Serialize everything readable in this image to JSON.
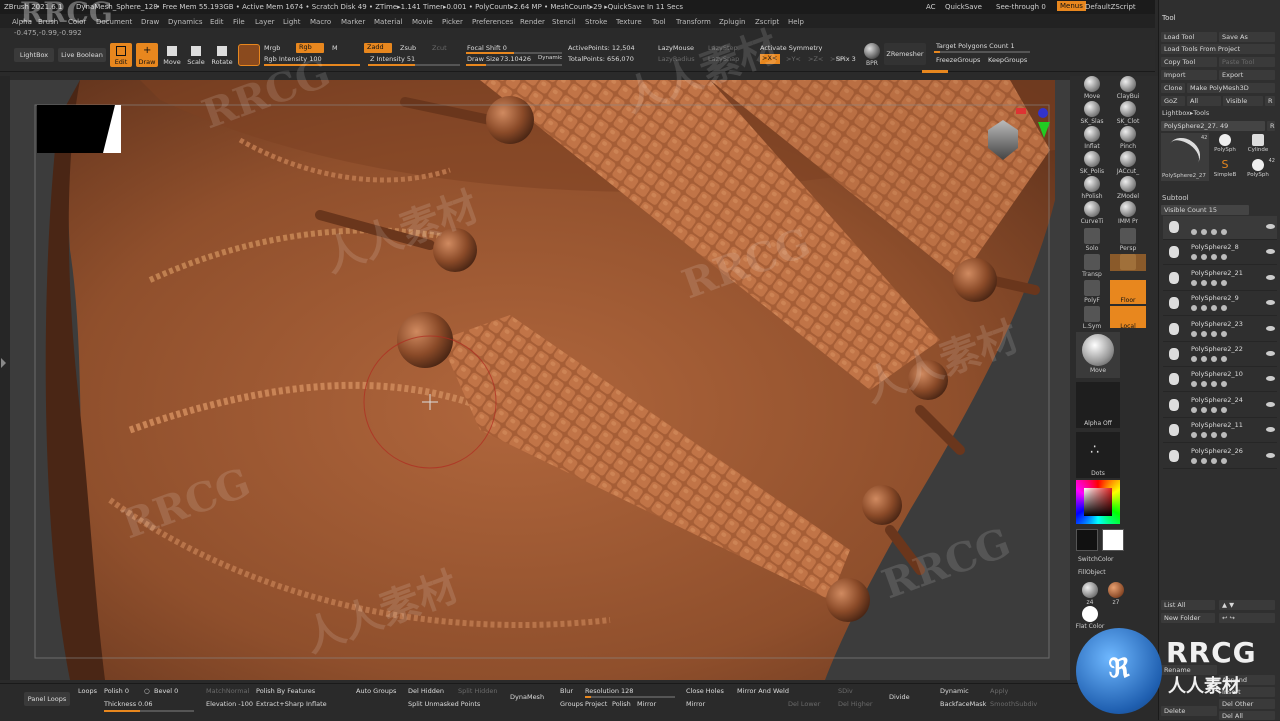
{
  "title_bar": {
    "app": "ZBrush 2021.6.1",
    "document": "DynaMesh_Sphere_128",
    "stats": "• Free Mem 55.193GB • Active Mem 1674 • Scratch Disk 49 • ZTime▸1.141 Timer▸0.001 • PolyCount▸2.64 MP • MeshCount▸29 ▸QuickSave In 11 Secs",
    "ac": "AC",
    "quicksave": "QuickSave",
    "see_through": "See-through",
    "see_through_value": "0",
    "menus": "Menus",
    "default_script": "DefaultZScript"
  },
  "menu_bar": {
    "items": [
      "Alpha",
      "Brush",
      "Color",
      "Document",
      "Draw",
      "Dynamics",
      "Edit",
      "File",
      "Layer",
      "Light",
      "Macro",
      "Marker",
      "Material",
      "Movie",
      "Picker",
      "Preferences",
      "Render",
      "Stencil",
      "Stroke",
      "Texture",
      "Tool",
      "Transform",
      "Zplugin",
      "Zscript",
      "Help"
    ],
    "coords": "-0.475,-0.99,-0.992"
  },
  "shelf": {
    "lightbox": "LightBox",
    "live_boolean": "Live Boolean",
    "edit": "Edit",
    "draw": "Draw",
    "move": "Move",
    "scale": "Scale",
    "rotate": "Rotate",
    "mrgb": "Mrgb",
    "rgb": "Rgb",
    "m": "M",
    "rgb_intensity": "Rgb Intensity 100",
    "zadd": "Zadd",
    "zsub": "Zsub",
    "zcut": "Zcut",
    "z_intensity": "Z Intensity 51",
    "focal_shift": "Focal Shift 0",
    "draw_size_label": "Draw Size",
    "draw_size_value": "73.10426",
    "dynamic": "Dynamic",
    "active_points": "ActivePoints: 12,504",
    "total_points": "TotalPoints: 656,070",
    "lazy_mouse": "LazyMouse",
    "lazy_step": "LazyStep",
    "lazy_radius": "LazyRadius",
    "lazy_snap": "LazySnap",
    "activate_symmetry": "Activate Symmetry",
    "sym_x": ">X<",
    "sym_y": ">Y<",
    "sym_z": ">Z<",
    "sym_m": ">M<",
    "spix": "SPix 3",
    "bpr": "BPR",
    "zremesher": "ZRemesher",
    "target_polygons": "Target Polygons Count 1",
    "freeze_groups": "FreezeGroups",
    "keep_groups": "KeepGroups"
  },
  "mid_tray": {
    "items": [
      "Move",
      "ClayBui",
      "SK_Slas",
      "SK_Clot",
      "Inflat",
      "Pinch",
      "SK_Polis",
      "JACcut_",
      "hPolish",
      "ZModel",
      "CurveTi",
      "IMM Pr",
      "Solo",
      "Persp",
      "Transp",
      "Floor",
      "PolyF",
      "L.Sym",
      "Local"
    ],
    "move_preview": "Move",
    "alpha_off": "Alpha Off",
    "dots": "Dots",
    "switch_color": "SwitchColor",
    "fill_object": "FillObject",
    "z4": "z4",
    "z7": "z7",
    "flat_color": "Flat Color",
    "primary_color": "#e8702a",
    "secondary_color": "#ffffff"
  },
  "tool_panel": {
    "header": "Tool",
    "buttons": [
      "Load Tool",
      "Save As",
      "Load Tools From Project",
      "Copy Tool",
      "Paste Tool",
      "Import",
      "Export",
      "Clone",
      "Make PolyMesh3D",
      "GoZ",
      "All",
      "Visible",
      "R"
    ],
    "lightbox_tools": "Lightbox▸Tools",
    "current_tool": "PolySphere2_27",
    "current_tool_value": "49",
    "thumbs": [
      "PolySphere2_27",
      "PolySph",
      "Cylinde",
      "SimpleB",
      "PolySph"
    ],
    "thumb_counts": [
      "42",
      "42"
    ],
    "subtool_header": "Subtool",
    "visible_count_label": "Visible Count",
    "visible_count_value": "15",
    "subtools": [
      "",
      "PolySphere2_8",
      "PolySphere2_21",
      "PolySphere2_9",
      "PolySphere2_23",
      "PolySphere2_22",
      "PolySphere2_10",
      "PolySphere2_24",
      "PolySphere2_11",
      "PolySphere2_26"
    ],
    "list_all": "List All",
    "new_folder": "New Folder",
    "bottom": [
      "Rename",
      "Lock",
      "Append",
      "Insert",
      "Delete",
      "Del Other",
      "Del All"
    ]
  },
  "bottom_bar": {
    "panel_loops": "Panel Loops",
    "loops": "Loops",
    "polish": "Polish 0",
    "bevel": "Bevel 0",
    "thickness": "Thickness",
    "thickness_value": "0.06",
    "match_normal": "MatchNormal",
    "polish_by_features": "Polish By Features",
    "elevation": "Elevation -100",
    "extract_sharp": "Extract+Sharp",
    "inflate": "Inflate",
    "auto_groups": "Auto Groups",
    "del_hidden": "Del Hidden",
    "split_hidden": "Split Hidden",
    "split_unmasked": "Split Unmasked Points",
    "dynamesh": "DynaMesh",
    "blur": "Blur",
    "resolution": "Resolution 128",
    "groups": "Groups",
    "project": "Project",
    "polish2": "Polish",
    "mirror": "Mirror",
    "close_holes": "Close Holes",
    "mirror_and_weld": "Mirror And Weld",
    "mirror2": "Mirror",
    "sdiv": "SDiv",
    "del_lower": "Del Lower",
    "del_higher": "Del Higher",
    "divide": "Divide",
    "dynamic": "Dynamic",
    "apply": "Apply",
    "backface_mask": "BackfaceMask",
    "smooth_subdiv": "SmoothSubdiv"
  },
  "watermarks": {
    "brand": "RRCG",
    "cn": "人人素材"
  }
}
